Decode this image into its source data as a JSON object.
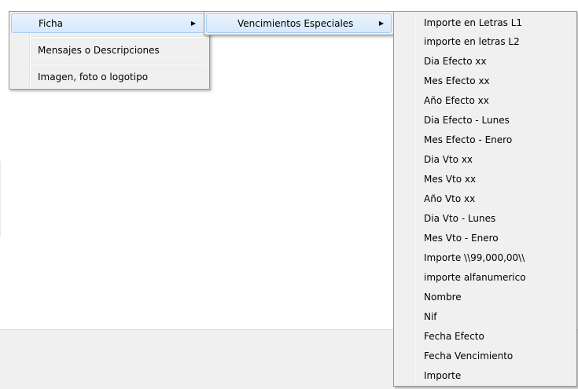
{
  "menu_level1": {
    "items": [
      {
        "label": "Ficha",
        "has_submenu": true
      },
      {
        "label": "Mensajes o Descripciones",
        "has_submenu": false
      },
      {
        "label": "Imagen, foto o logotipo",
        "has_submenu": false
      }
    ]
  },
  "menu_level2": {
    "items": [
      {
        "label": "Vencimientos Especiales",
        "has_submenu": true
      }
    ]
  },
  "menu_level3": {
    "items": [
      {
        "label": "Importe en Letras L1"
      },
      {
        "label": "importe en letras L2"
      },
      {
        "label": "Dia Efecto xx"
      },
      {
        "label": "Mes Efecto xx"
      },
      {
        "label": "Año Efecto xx"
      },
      {
        "label": "Dia Efecto - Lunes"
      },
      {
        "label": "Mes Efecto - Enero"
      },
      {
        "label": "Dia Vto xx"
      },
      {
        "label": "Mes Vto xx"
      },
      {
        "label": "Año Vto xx"
      },
      {
        "label": "Dia Vto - Lunes"
      },
      {
        "label": "Mes Vto - Enero"
      },
      {
        "label": "Importe \\\\99,000,00\\\\"
      },
      {
        "label": "importe alfanumerico"
      },
      {
        "label": "Nombre"
      },
      {
        "label": "Nif"
      },
      {
        "label": "Fecha Efecto"
      },
      {
        "label": "Fecha Vencimiento"
      },
      {
        "label": "Importe"
      }
    ]
  },
  "icons": {
    "submenu_arrow": "submenu-arrow-icon"
  },
  "colors": {
    "menu_background": "#f0f0f0",
    "menu_border": "#979797",
    "highlight_fill": "#dcebfc",
    "highlight_border": "#a8cdf3",
    "window_bottom_panel": "#f0f0f0"
  }
}
